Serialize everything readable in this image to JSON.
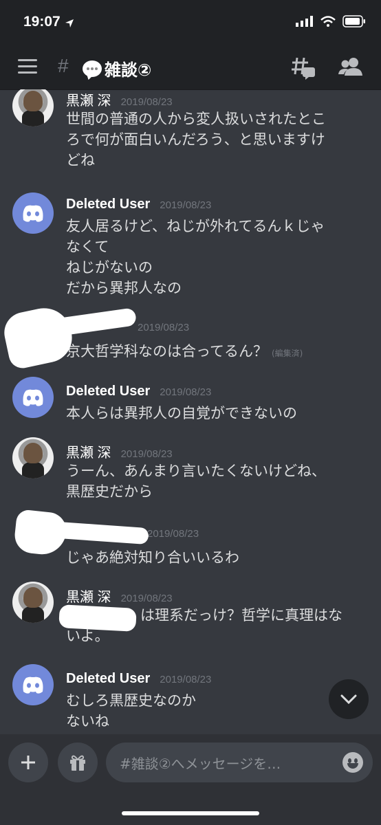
{
  "status": {
    "time": "19:07"
  },
  "header": {
    "hash": "#",
    "channel": "雑談②"
  },
  "messages": [
    {
      "author": "黒瀬 深",
      "timestamp": "2019/08/23",
      "lines": [
        "世間の普通の人から変人扱いされたとこ",
        "ろで何が面白いんだろう、と思いますけ",
        "どね"
      ]
    },
    {
      "author": "Deleted User",
      "timestamp": "2019/08/23",
      "lines": [
        "友人居るけど、ねじが外れてるんｋじゃ",
        "なくて",
        "ねじがないの",
        "だから異邦人なの"
      ]
    },
    {
      "author": "",
      "timestamp": "2019/08/23",
      "lines": [
        "京大哲学科なのは合ってるん？"
      ],
      "edited": "(編集済)"
    },
    {
      "author": "Deleted User",
      "timestamp": "2019/08/23",
      "lines": [
        "本人らは異邦人の自覚ができないの"
      ]
    },
    {
      "author": "黒瀬 深",
      "timestamp": "2019/08/23",
      "lines": [
        "うーん、あんまり言いたくないけどね、",
        "黒歴史だから"
      ]
    },
    {
      "author": "",
      "timestamp": "2019/08/23",
      "lines": [
        "じゃあ絶対知り合いいるわ"
      ]
    },
    {
      "author": "黒瀬 深",
      "timestamp": "2019/08/23",
      "lines": [
        "は理系だっけ？哲学に真理はな",
        "いよ。"
      ]
    },
    {
      "author": "Deleted User",
      "timestamp": "2019/08/23",
      "lines": [
        "むしろ黒歴史なのか",
        "ないね"
      ]
    }
  ],
  "composer": {
    "placeholder": "#雑談②へメッセージを…"
  },
  "colors": {
    "background": "#36393f",
    "header": "#202225",
    "blurple": "#7289da"
  }
}
